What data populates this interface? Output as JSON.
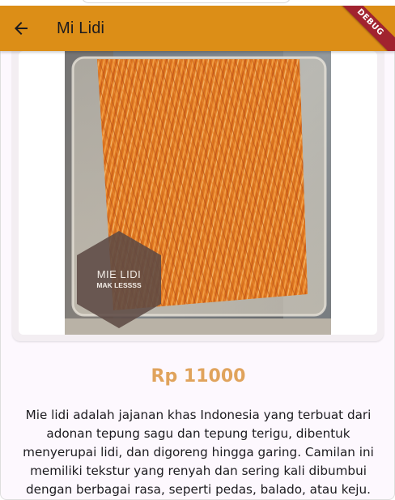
{
  "appbar": {
    "title": "Mi Lidi",
    "back_icon": "arrow-back-icon",
    "color": "#dc8e17"
  },
  "debug_banner": {
    "label": "DEBUG",
    "color": "#a1232f"
  },
  "product": {
    "image_label_line1": "MIE LIDI",
    "image_label_line2": "MAK LESSSS",
    "price": "Rp 11000",
    "price_color": "#e0a35c",
    "description": "Mie lidi adalah jajanan khas Indonesia yang terbuat dari adonan tepung sagu dan tepung terigu, dibentuk menyerupai lidi, dan digoreng hingga garing. Camilan ini memiliki tekstur yang renyah dan sering kali dibumbui dengan berbagai rasa, seperti pedas, balado, atau keju."
  }
}
